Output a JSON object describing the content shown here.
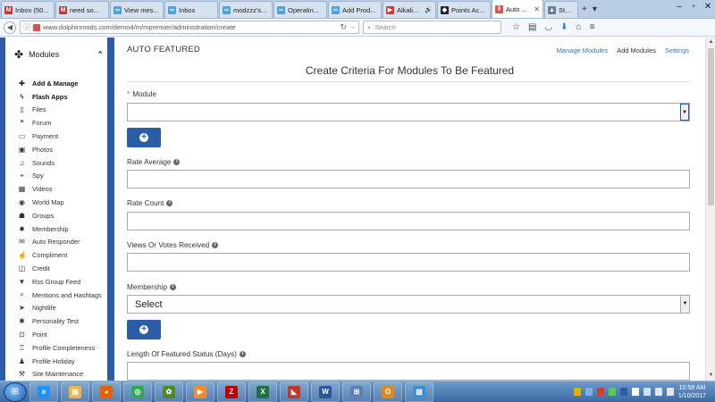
{
  "browser": {
    "tabs": [
      {
        "label": "Inbox (50...",
        "icon": "gmail-icon",
        "color": "#d93025",
        "glyph": "M"
      },
      {
        "label": "need so...",
        "icon": "gmail-icon",
        "color": "#d93025",
        "glyph": "M"
      },
      {
        "label": "View mes...",
        "icon": "dolphin-icon",
        "color": "#4aa3df",
        "glyph": "∞"
      },
      {
        "label": "Inbox",
        "icon": "dolphin-icon",
        "color": "#4aa3df",
        "glyph": "∞"
      },
      {
        "label": "modzzz's...",
        "icon": "dolphin-icon",
        "color": "#4aa3df",
        "glyph": "∞"
      },
      {
        "label": "Operatin...",
        "icon": "dolphin-icon",
        "color": "#4aa3df",
        "glyph": "∞"
      },
      {
        "label": "Add Prod...",
        "icon": "dolphin-icon",
        "color": "#4aa3df",
        "glyph": "∞"
      },
      {
        "label": "Alkali...",
        "icon": "youtube-icon",
        "color": "#e52d27",
        "glyph": "▶"
      },
      {
        "label": "Points Ac...",
        "icon": "site-icon",
        "color": "#222222",
        "glyph": "◆"
      },
      {
        "label": "Auto ...",
        "icon": "mpremier-icon",
        "color": "#d9534f",
        "glyph": "‖"
      },
      {
        "label": "Studi...",
        "icon": "studio-icon",
        "color": "#6b7c93",
        "glyph": "▲"
      }
    ],
    "url": "www.dolphinmods.com/demo4/m/mpremier/administration/create",
    "search_placeholder": "Search"
  },
  "sidebar": {
    "title": "Modules",
    "items": [
      {
        "label": "Add & Manage",
        "icon": "plus-icon",
        "glyph": "✚",
        "bold": true
      },
      {
        "label": "Flash Apps",
        "icon": "bolt-icon",
        "glyph": "ϟ",
        "bold": true
      },
      {
        "label": "Files",
        "icon": "file-icon",
        "glyph": "▯"
      },
      {
        "label": "Forum",
        "icon": "comments-icon",
        "glyph": "❝"
      },
      {
        "label": "Payment",
        "icon": "credit-card-icon",
        "glyph": "▭"
      },
      {
        "label": "Photos",
        "icon": "image-icon",
        "glyph": "▣"
      },
      {
        "label": "Sounds",
        "icon": "music-icon",
        "glyph": "♫"
      },
      {
        "label": "Spy",
        "icon": "crosshairs-icon",
        "glyph": "⌖"
      },
      {
        "label": "Videos",
        "icon": "film-icon",
        "glyph": "▦"
      },
      {
        "label": "World Map",
        "icon": "globe-icon",
        "glyph": "◉"
      },
      {
        "label": "Groups",
        "icon": "group-icon",
        "glyph": "☗"
      },
      {
        "label": "Membership",
        "icon": "certificate-icon",
        "glyph": "✹"
      },
      {
        "label": "Auto Responder",
        "icon": "envelope-icon",
        "glyph": "✉"
      },
      {
        "label": "Compliment",
        "icon": "thumbs-up-icon",
        "glyph": "☝"
      },
      {
        "label": "Credit",
        "icon": "credit-icon",
        "glyph": "◫"
      },
      {
        "label": "Rss Group Feed",
        "icon": "filter-icon",
        "glyph": "▼"
      },
      {
        "label": "Mentions and Hashtags",
        "icon": "search-plus-icon",
        "glyph": "⌕"
      },
      {
        "label": "Nightlife",
        "icon": "paper-plane-icon",
        "glyph": "➤"
      },
      {
        "label": "Personality Test",
        "icon": "asterisk-icon",
        "glyph": "✱"
      },
      {
        "label": "Point",
        "icon": "point-icon",
        "glyph": "⊡"
      },
      {
        "label": "Profile Completeness",
        "icon": "trophy-icon",
        "glyph": "♖"
      },
      {
        "label": "Profile Holiday",
        "icon": "user-icon",
        "glyph": "♟"
      },
      {
        "label": "Site Maintenance",
        "icon": "wrench-icon",
        "glyph": "⚒"
      }
    ]
  },
  "main": {
    "page_title": "AUTO FEATURED",
    "nav": {
      "manage": "Manage Modules",
      "add": "Add Modules",
      "settings": "Settings"
    },
    "form_title": "Create Criteria For Modules To Be Featured",
    "fields": {
      "module": {
        "label": "Module",
        "required": "*",
        "value": ""
      },
      "rate_average": {
        "label": "Rate Average"
      },
      "rate_count": {
        "label": "Rate Count"
      },
      "views_votes": {
        "label": "Views Or Votes Received"
      },
      "membership": {
        "label": "Membership",
        "value": "Select"
      },
      "length": {
        "label": "Length Of Featured Status (Days)"
      }
    }
  },
  "taskbar": {
    "apps": [
      {
        "name": "ie-icon",
        "color": "#1e90ff",
        "glyph": "e"
      },
      {
        "name": "explorer-icon",
        "color": "#e8b84a",
        "glyph": "▤"
      },
      {
        "name": "firefox-icon",
        "color": "#e66000",
        "glyph": "◕"
      },
      {
        "name": "chrome-icon",
        "color": "#34a853",
        "glyph": "◎"
      },
      {
        "name": "frog-icon",
        "color": "#4c8a2a",
        "glyph": "✿"
      },
      {
        "name": "media-player-icon",
        "color": "#f28c28",
        "glyph": "▶"
      },
      {
        "name": "filezilla-icon",
        "color": "#bf0000",
        "glyph": "Z"
      },
      {
        "name": "excel-icon",
        "color": "#1e7145",
        "glyph": "X"
      },
      {
        "name": "eraser-icon",
        "color": "#c0392b",
        "glyph": "◣"
      },
      {
        "name": "word-icon",
        "color": "#2b579a",
        "glyph": "W"
      },
      {
        "name": "rdp-icon",
        "color": "#5b7fb8",
        "glyph": "⊞"
      },
      {
        "name": "outlook-icon",
        "color": "#e08a1e",
        "glyph": "O"
      },
      {
        "name": "photo-viewer-icon",
        "color": "#3b8ed0",
        "glyph": "▧"
      }
    ],
    "time": "10:58 AM",
    "date": "1/10/2017"
  }
}
